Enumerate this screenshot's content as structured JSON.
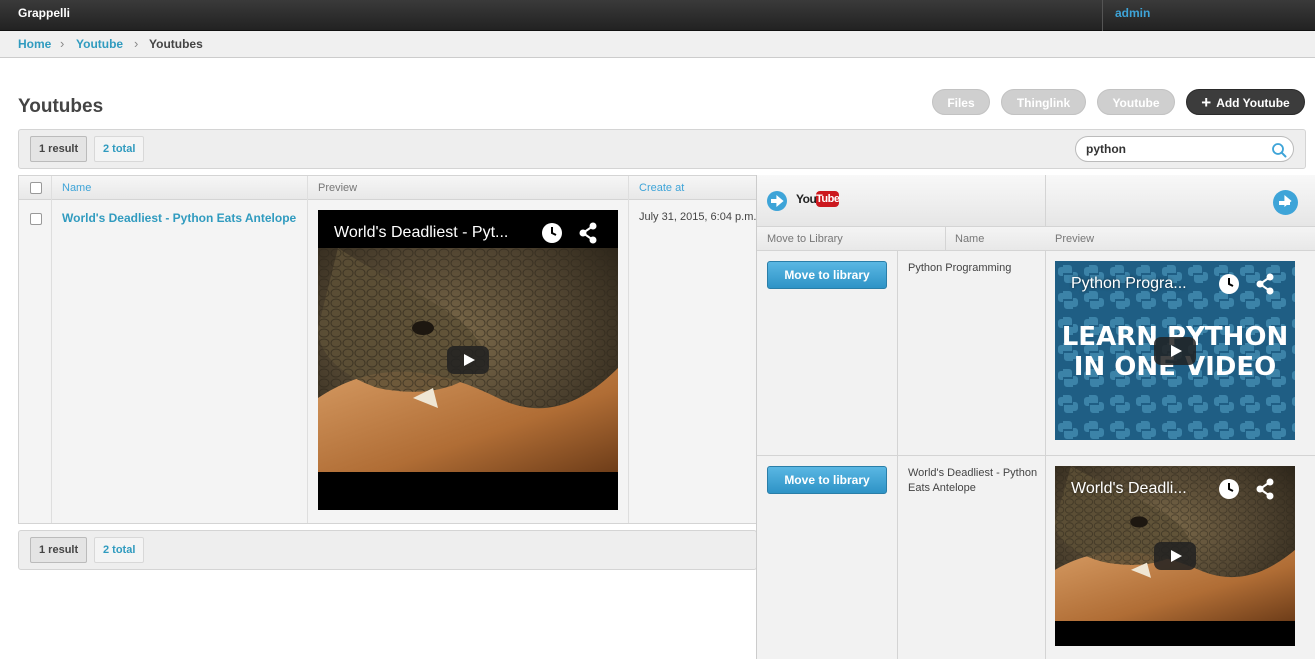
{
  "app": {
    "brand": "Grappelli",
    "user": "admin"
  },
  "breadcrumbs": [
    "Home",
    "Youtube",
    "Youtubes"
  ],
  "page_title": "Youtubes",
  "object_tools": {
    "files": "Files",
    "thinglink": "Thinglink",
    "youtube": "Youtube",
    "add": "Add Youtube"
  },
  "toolbar": {
    "result_count": "1 result",
    "total_count": "2 total"
  },
  "search": {
    "value": "python"
  },
  "table": {
    "columns": {
      "name": "Name",
      "preview": "Preview",
      "created": "Create at"
    },
    "rows": [
      {
        "name": "World's Deadliest - Python Eats Antelope",
        "video_title": "World's Deadliest - Pyt...",
        "created": "July 31, 2015, 6:04 p.m."
      }
    ]
  },
  "youtube_panel": {
    "logo_you": "You",
    "logo_tube": "Tube",
    "columns": {
      "move": "Move to Library",
      "name": "Name",
      "preview": "Preview"
    },
    "results": [
      {
        "button": "Move to library",
        "name": "Python Programming",
        "video_title": "Python Progra...",
        "thumb_text_line1": "LEARN PYTHON",
        "thumb_text_line2": "IN ONE VIDEO"
      },
      {
        "button": "Move to library",
        "name": "World's Deadliest - Python Eats Antelope",
        "video_title": "World's Deadli..."
      }
    ]
  },
  "colors": {
    "accent": "#309bbf",
    "header": "#2b2b2b",
    "youtube_red": "#cc181e"
  }
}
